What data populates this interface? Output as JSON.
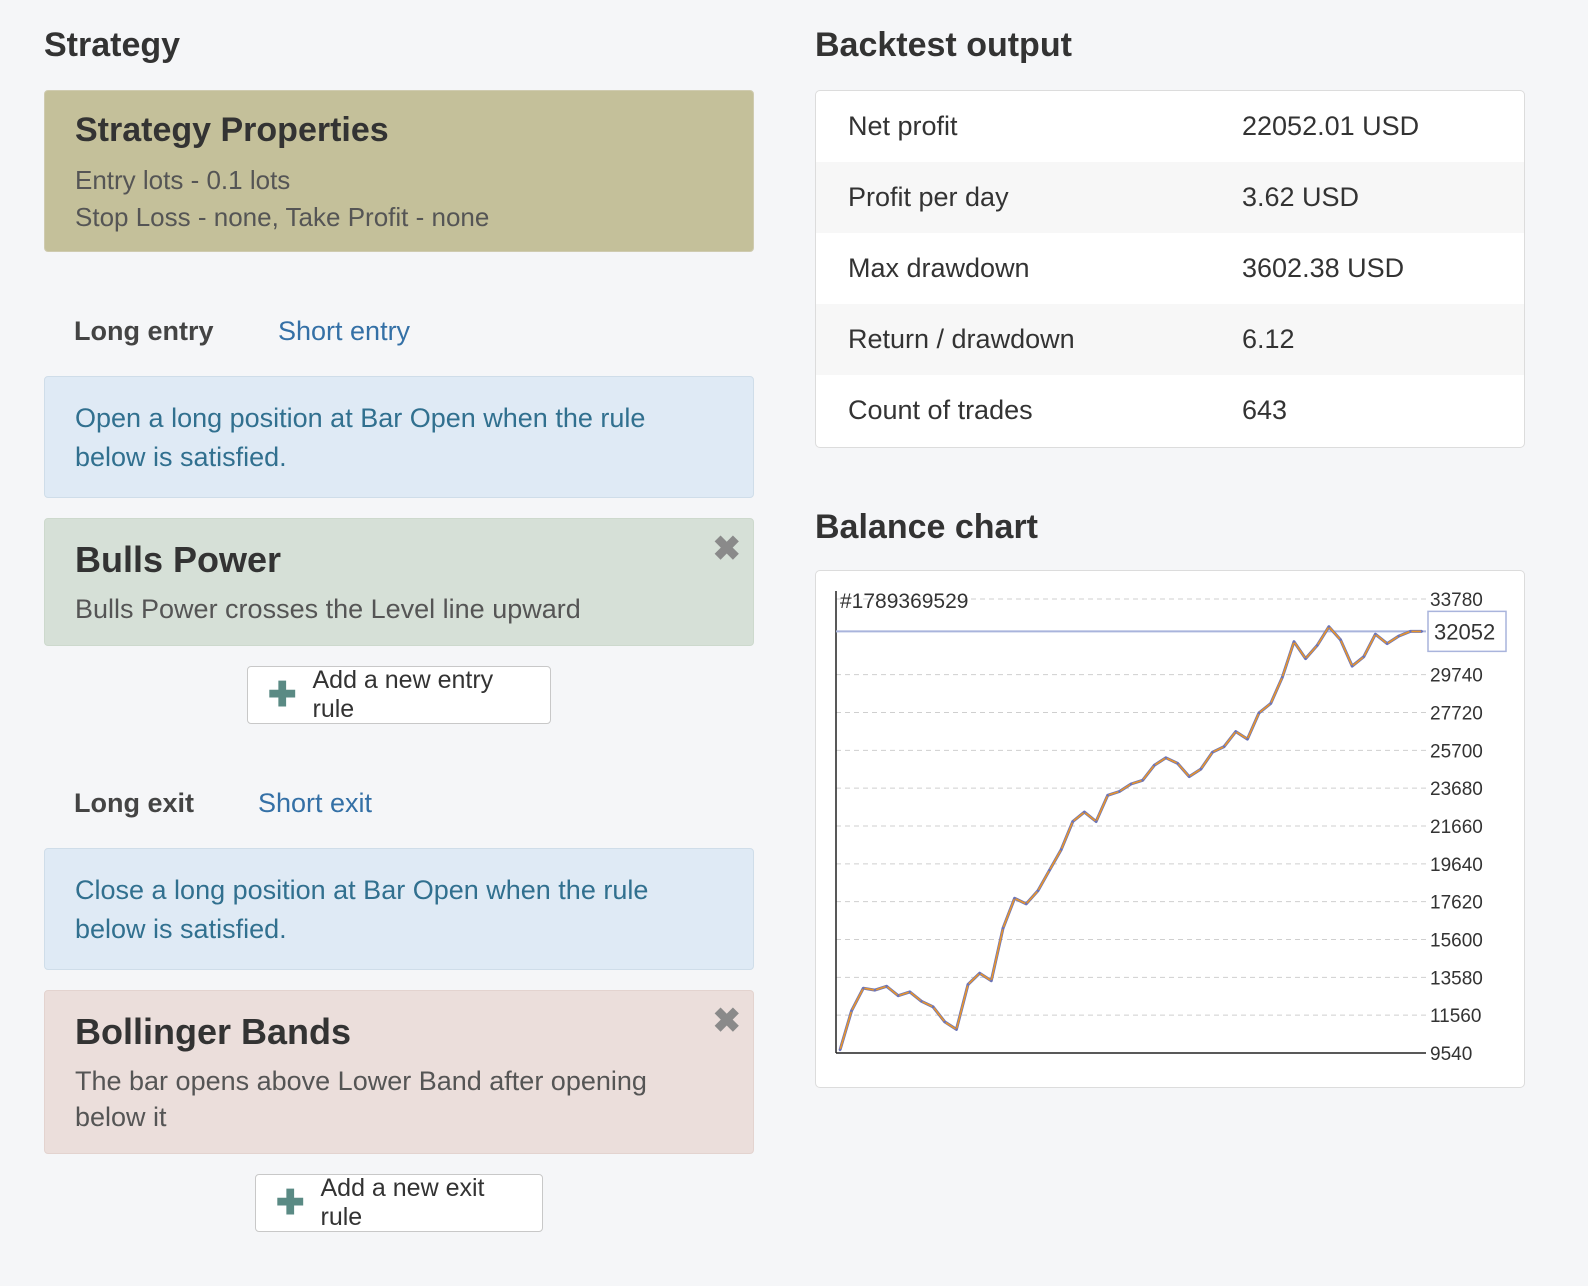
{
  "strategy": {
    "heading": "Strategy",
    "properties": {
      "title": "Strategy Properties",
      "line1": "Entry lots - 0.1 lots",
      "line2": "Stop Loss - none, Take Profit - none"
    },
    "entry_tabs": {
      "long": "Long entry",
      "short": "Short entry"
    },
    "entry_info": "Open a long position at Bar Open when the rule below is satisfied.",
    "entry_rule": {
      "title": "Bulls Power",
      "desc": "Bulls Power crosses the Level line upward"
    },
    "add_entry_label": "Add a new entry rule",
    "exit_tabs": {
      "long": "Long exit",
      "short": "Short exit"
    },
    "exit_info": "Close a long position at Bar Open when the rule below is satisfied.",
    "exit_rule": {
      "title": "Bollinger Bands",
      "desc": "The bar opens above Lower Band after opening below it"
    },
    "add_exit_label": "Add a new exit rule",
    "close_glyph": "✖",
    "plus_glyph": "✚"
  },
  "backtest": {
    "heading": "Backtest output",
    "rows": [
      {
        "key": "Net profit",
        "value": "22052.01 USD"
      },
      {
        "key": "Profit per day",
        "value": "3.62 USD"
      },
      {
        "key": "Max drawdown",
        "value": "3602.38 USD"
      },
      {
        "key": "Return / drawdown",
        "value": "6.12"
      },
      {
        "key": "Count of trades",
        "value": "643"
      }
    ]
  },
  "balance": {
    "heading": "Balance chart"
  },
  "colors": {
    "line_up": "#e8952c",
    "line_down": "#6b74b8",
    "marker": "#a9b4dc"
  },
  "chart_data": {
    "type": "line",
    "title": "#1789369529",
    "xlabel": "",
    "ylabel": "",
    "ylim": [
      9540,
      33780
    ],
    "yticks": [
      33780,
      29740,
      27720,
      25700,
      23680,
      21660,
      19640,
      17620,
      15600,
      13580,
      11560,
      9540
    ],
    "current_value": 32052,
    "grid": true,
    "series": [
      {
        "x": [
          0,
          2,
          4,
          6,
          8,
          10,
          12,
          14,
          16,
          18,
          20,
          22,
          24,
          26,
          28,
          30,
          32,
          34,
          36,
          38,
          40,
          42,
          44,
          46,
          48,
          50,
          52,
          54,
          56,
          58,
          60,
          62,
          64,
          66,
          68,
          70,
          72,
          74,
          76,
          78,
          80,
          82,
          84,
          86,
          88,
          90,
          92,
          94,
          96,
          98,
          100
        ],
        "values": [
          9700,
          11800,
          13000,
          12900,
          13100,
          12600,
          12800,
          12300,
          12000,
          11200,
          10800,
          13200,
          13800,
          13400,
          16200,
          17800,
          17500,
          18200,
          19300,
          20400,
          21900,
          22400,
          21900,
          23300,
          23500,
          23900,
          24100,
          24900,
          25300,
          25000,
          24300,
          24700,
          25600,
          25900,
          26700,
          26300,
          27700,
          28200,
          29600,
          31500,
          30600,
          31300,
          32300,
          31600,
          30200,
          30700,
          31900,
          31400,
          31800,
          32052,
          32052
        ]
      }
    ]
  }
}
